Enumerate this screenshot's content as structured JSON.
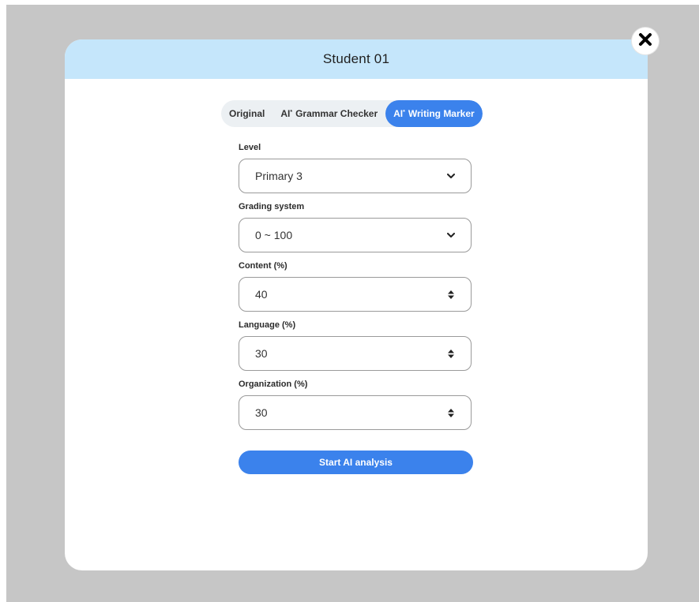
{
  "modal": {
    "title": "Student 01"
  },
  "tabs": [
    {
      "prefix": "",
      "label": "Original",
      "active": false
    },
    {
      "prefix": "AI",
      "label": "Grammar Checker",
      "active": false
    },
    {
      "prefix": "AI",
      "label": "Writing Marker",
      "active": true
    }
  ],
  "form": {
    "level": {
      "label": "Level",
      "value": "Primary 3"
    },
    "grading_system": {
      "label": "Grading system",
      "value": "0 ~ 100"
    },
    "content": {
      "label": "Content (%)",
      "value": "40"
    },
    "language": {
      "label": "Language (%)",
      "value": "30"
    },
    "organization": {
      "label": "Organization (%)",
      "value": "30"
    }
  },
  "actions": {
    "start_label": "Start AI analysis"
  },
  "icons": {
    "close": "close-icon",
    "dropdown": "chevron-down-icon",
    "stepper": "stepper-icon"
  },
  "colors": {
    "accent": "#3b82ec",
    "header_bg": "#c5e6fb",
    "backdrop": "#c6c6c6"
  }
}
